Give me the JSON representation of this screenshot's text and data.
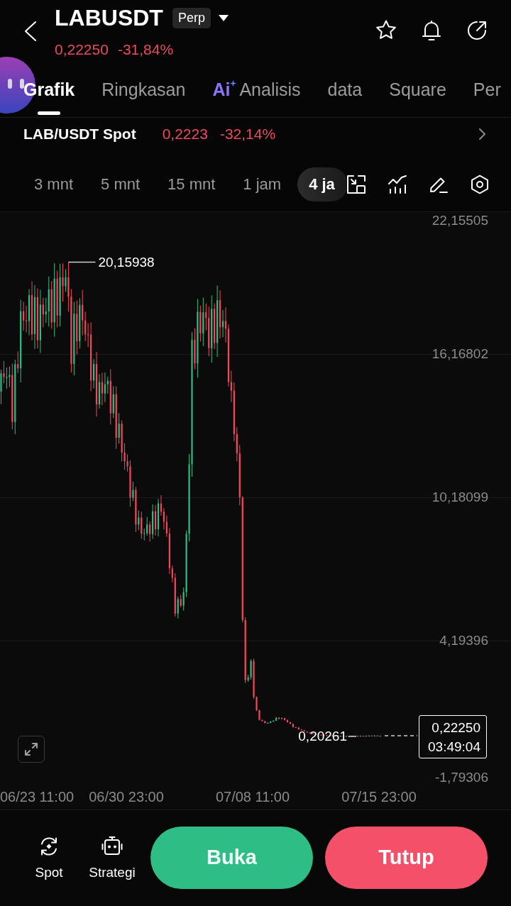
{
  "header": {
    "symbol": "LABUSDT",
    "contract_type": "Perp",
    "price": "0,22250",
    "change": "-31,84%"
  },
  "tabs": [
    {
      "label": "Grafik",
      "selected": true
    },
    {
      "label": "Ringkasan",
      "selected": false
    },
    {
      "label": "Analisis",
      "selected": false,
      "prefix": "Ai"
    },
    {
      "label": "data",
      "selected": false
    },
    {
      "label": "Square",
      "selected": false
    },
    {
      "label": "Per",
      "selected": false
    }
  ],
  "spot_market": {
    "pair": "LAB/USDT Spot",
    "price": "0,2223",
    "change": "-32,14%"
  },
  "timeframes": [
    {
      "label": "3 mnt",
      "selected": false
    },
    {
      "label": "5 mnt",
      "selected": false
    },
    {
      "label": "15 mnt",
      "selected": false
    },
    {
      "label": "1 jam",
      "selected": false
    },
    {
      "label": "4 ja",
      "selected": true
    }
  ],
  "chart": {
    "y_axis_labels": [
      "22,15505",
      "16,16802",
      "10,18099",
      "4,19396",
      "-1,79306"
    ],
    "x_axis_labels": [
      "06/23 11:00",
      "06/30 23:00",
      "07/08 11:00",
      "07/15 23:00"
    ],
    "high_label": "20,15938",
    "low_label": "0,20261",
    "price_tag": {
      "price": "0,22250",
      "countdown": "03:49:04"
    }
  },
  "bottom_bar": {
    "shortcuts": [
      {
        "label": "Spot",
        "kind": "spot"
      },
      {
        "label": "Strategi",
        "kind": "strategy"
      }
    ],
    "actions": [
      {
        "label": "Buka",
        "kind": "buy"
      },
      {
        "label": "Tutup",
        "kind": "sell"
      }
    ]
  }
}
